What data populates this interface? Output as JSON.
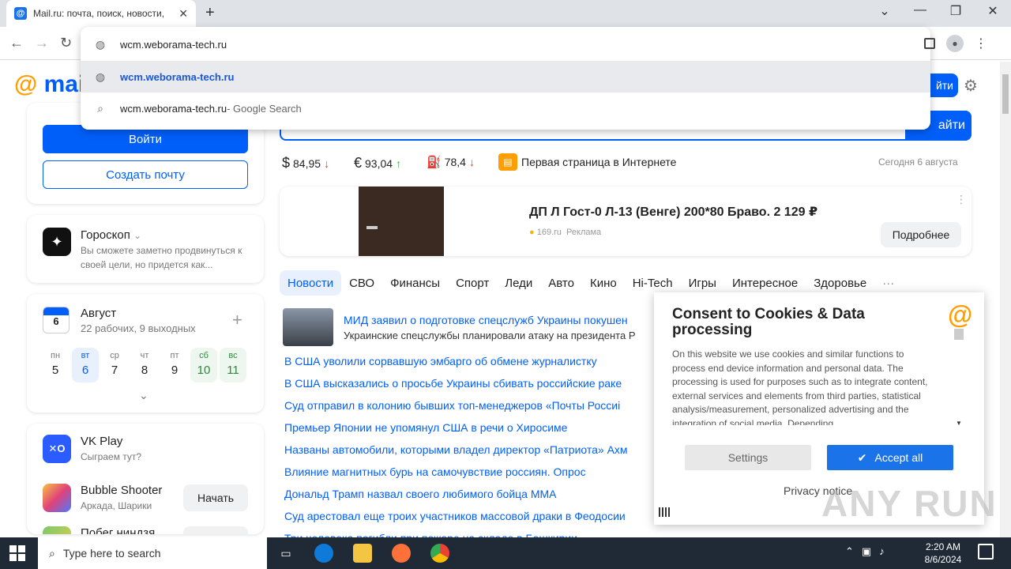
{
  "browser": {
    "tab_title": "Mail.ru: почта, поиск, новости,",
    "tab_favicon": "@",
    "new_tab": "+",
    "address_value": "wcm.weborama-tech.ru",
    "suggestions": [
      {
        "text": "wcm.weborama-tech.ru",
        "suffix": ""
      },
      {
        "text": "wcm.weborama-tech.ru",
        "suffix": " - Google Search"
      }
    ]
  },
  "header": {
    "logo_at": "@",
    "logo_text": "mai",
    "login_label": "йти"
  },
  "auth": {
    "login_button": "Войти",
    "create_mail": "Создать почту"
  },
  "horoscope": {
    "title": "Гороскоп",
    "text": "Вы сможете заметно продвинуться к своей цели, но придется как..."
  },
  "calendar": {
    "icon_day": "6",
    "month": "Август",
    "summary": "22 рабочих, 9 выходных",
    "add": "+",
    "days": [
      {
        "name": "пн",
        "num": "5"
      },
      {
        "name": "вт",
        "num": "6"
      },
      {
        "name": "ср",
        "num": "7"
      },
      {
        "name": "чт",
        "num": "8"
      },
      {
        "name": "пт",
        "num": "9"
      },
      {
        "name": "сб",
        "num": "10"
      },
      {
        "name": "вс",
        "num": "11"
      }
    ],
    "expand": "⌄"
  },
  "games": {
    "vk_title": "VK Play",
    "vk_sub": "Сыграем тут?",
    "g1_title": "Bubble Shooter",
    "g1_sub": "Аркада, Шарики",
    "g1_btn": "Начать",
    "g2_title": "Побег ниндзя",
    "g2_btn": "Н"
  },
  "search": {
    "button_label": "айти"
  },
  "rates": {
    "usd_sym": "$",
    "usd": "84,95",
    "eur_sym": "€",
    "eur": "93,04",
    "oil": "78,4",
    "first_page": "Первая страница в Интернете",
    "date": "Сегодня 6 августа"
  },
  "ad": {
    "title": "ДП Л Гост-0 Л-13 (Венге) 200*80 Браво. 2 129 ₽",
    "source": "169.ru",
    "label": "Реклама",
    "button": "Подробнее",
    "menu": "⋮"
  },
  "news_tabs": [
    "Новости",
    "СВО",
    "Финансы",
    "Спорт",
    "Леди",
    "Авто",
    "Кино",
    "Hi-Tech",
    "Игры",
    "Интересное",
    "Здоровье",
    "···"
  ],
  "news": {
    "top_title": "МИД заявил о подготовке спецслужб Украины покушен",
    "top_sub": "Украинские спецслужбы планировали атаку на президента Р",
    "items": [
      "В США уволили сорвавшую эмбарго об обмене журналистку",
      "В США высказались о просьбе Украины сбивать российские раке",
      "Суд отправил в колонию бывших топ-менеджеров «Почты Россиі",
      "Премьер Японии не упомянул США в речи о Хиросиме",
      "Названы автомобили, которыми владел директор «Патриота» Ахм",
      "Влияние магнитных бурь на самочувствие россиян. Опрос",
      "Дональд Трамп назвал своего любимого бойца ММА",
      "Суд арестовал еще троих участников массовой драки в Феодосии",
      "Три человека погибли при пожаре на складе в Башкирии"
    ]
  },
  "cookie": {
    "title": "Consent to Cookies & Data processing",
    "body": "On this website we use cookies and similar functions to process end device information and personal data. The processing is used for purposes such as to integrate content, external services and elements from third parties, statistical analysis/measurement, personalized advertising and the integration of social media. Depending",
    "settings": "Settings",
    "accept": "Accept all",
    "privacy": "Privacy notice"
  },
  "watermark": "ANY RUN",
  "taskbar": {
    "search_placeholder": "Type here to search",
    "time": "2:20 AM",
    "date": "8/6/2024"
  },
  "colors": {
    "accent": "#005ff9",
    "brand_orange": "#ff9e00",
    "down": "#e5372b",
    "up": "#2bb24c"
  }
}
